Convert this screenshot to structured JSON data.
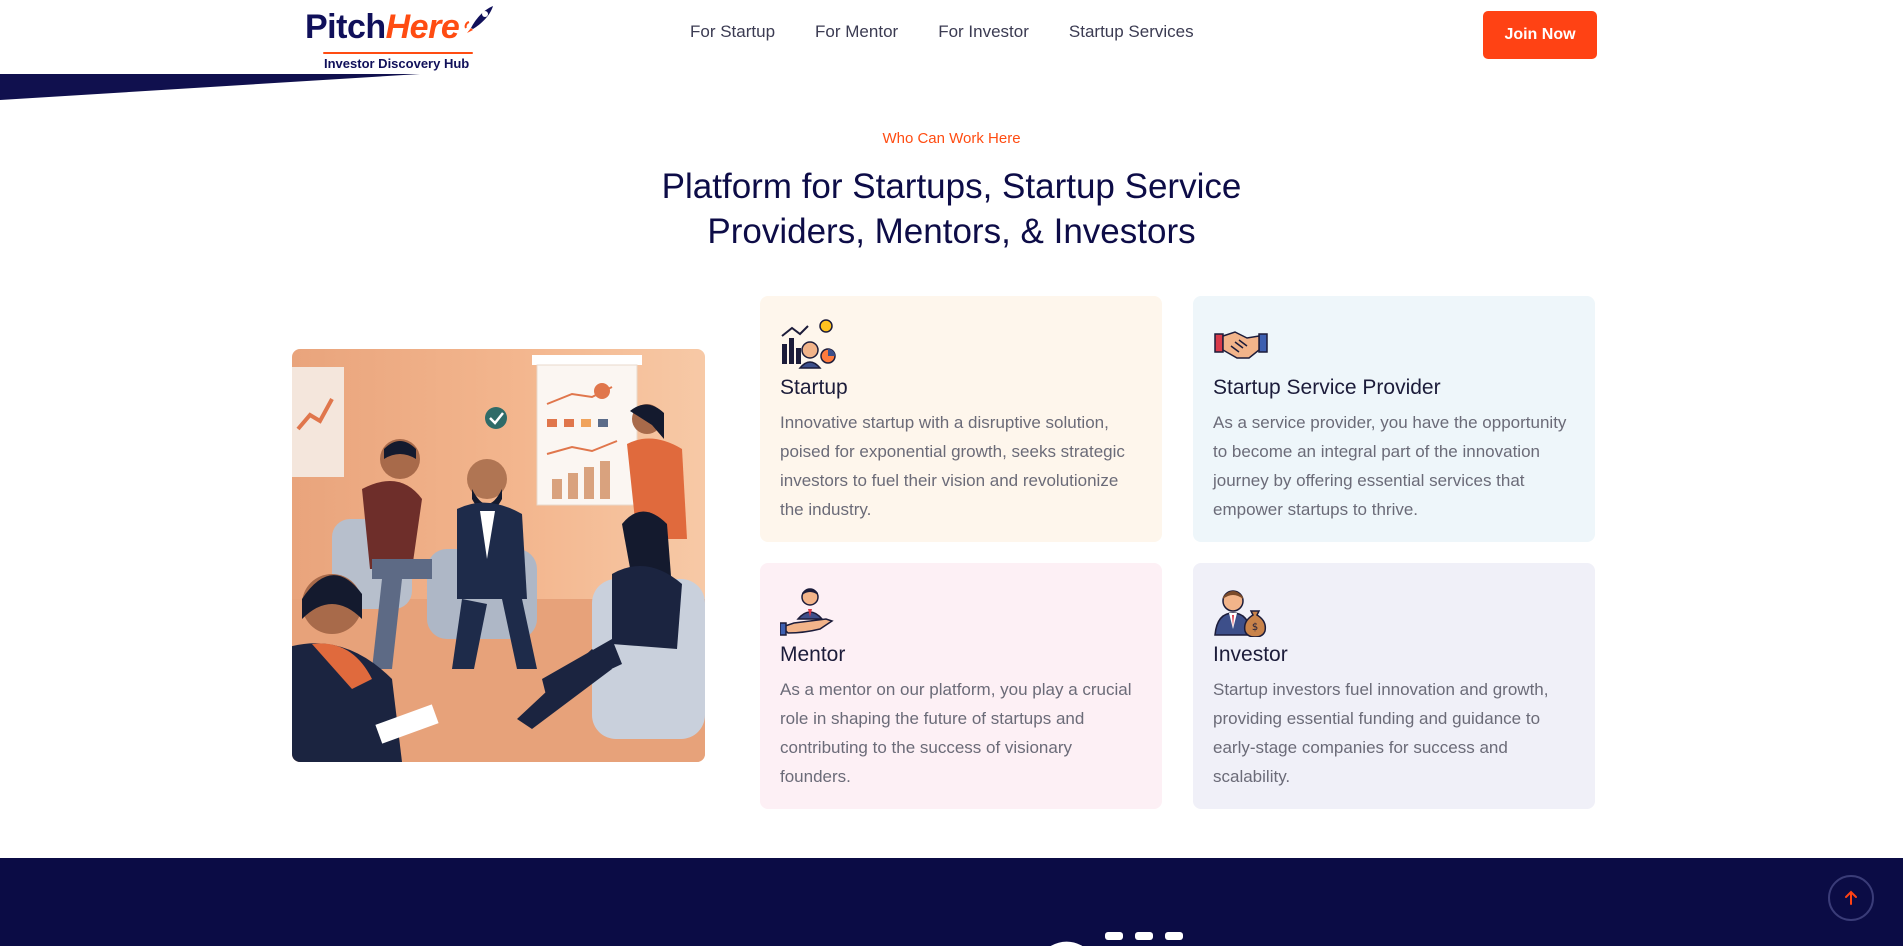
{
  "header": {
    "logo": {
      "word_part1": "Pitch",
      "word_part2": "Here",
      "tagline": "Investor Discovery Hub"
    },
    "nav": [
      {
        "label": "For Startup"
      },
      {
        "label": "For Mentor"
      },
      {
        "label": "For Investor"
      },
      {
        "label": "Startup Services"
      }
    ],
    "cta_label": "Join Now"
  },
  "section": {
    "eyebrow": "Who Can Work Here",
    "title_line1": "Platform for Startups, Startup Service",
    "title_line2": "Providers, Mentors, & Investors",
    "cards": [
      {
        "icon": "startup-growth-icon",
        "title": "Startup",
        "description": "Innovative startup with a disruptive solution, poised for exponential growth, seeks strategic investors to fuel their vision and revolutionize the industry."
      },
      {
        "icon": "handshake-icon",
        "title": "Startup Service Provider",
        "description": "As a service provider, you have the opportunity to become an integral part of the innovation journey by offering essential services that empower startups to thrive."
      },
      {
        "icon": "mentor-hand-icon",
        "title": "Mentor",
        "description": "As a mentor on our platform, you play a crucial role in shaping the future of startups and contributing to the success of visionary founders."
      },
      {
        "icon": "investor-moneybag-icon",
        "title": "Investor",
        "description": "Startup investors fuel innovation and growth, providing essential funding and guidance to early-stage companies for success and scalability."
      }
    ]
  },
  "colors": {
    "brand_navy": "#0d0c47",
    "accent_orange": "#ff4214",
    "footer_bg": "#0b0c45"
  },
  "icons": {
    "scroll_top": "arrow-up-icon",
    "logo_rocket": "rocket-icon"
  }
}
